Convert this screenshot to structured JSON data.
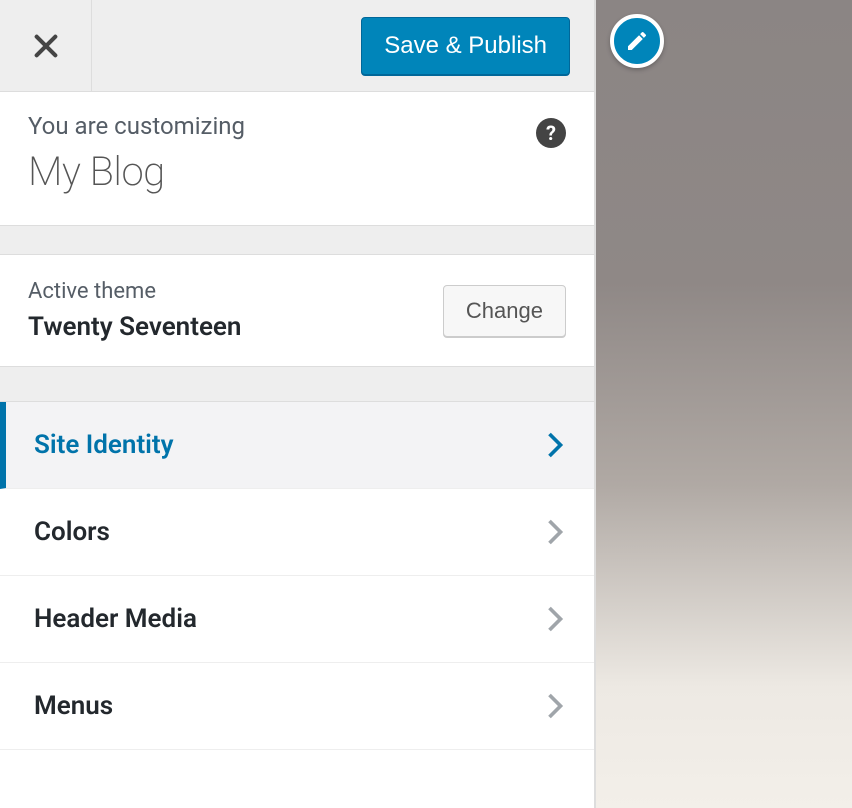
{
  "toolbar": {
    "save_label": "Save & Publish"
  },
  "header": {
    "customize_label": "You are customizing",
    "site_title": "My Blog",
    "help_glyph": "?"
  },
  "theme": {
    "label": "Active theme",
    "name": "Twenty Seventeen",
    "change_label": "Change"
  },
  "menu": {
    "items": [
      {
        "label": "Site Identity",
        "active": true
      },
      {
        "label": "Colors",
        "active": false
      },
      {
        "label": "Header Media",
        "active": false
      },
      {
        "label": "Menus",
        "active": false
      }
    ]
  }
}
